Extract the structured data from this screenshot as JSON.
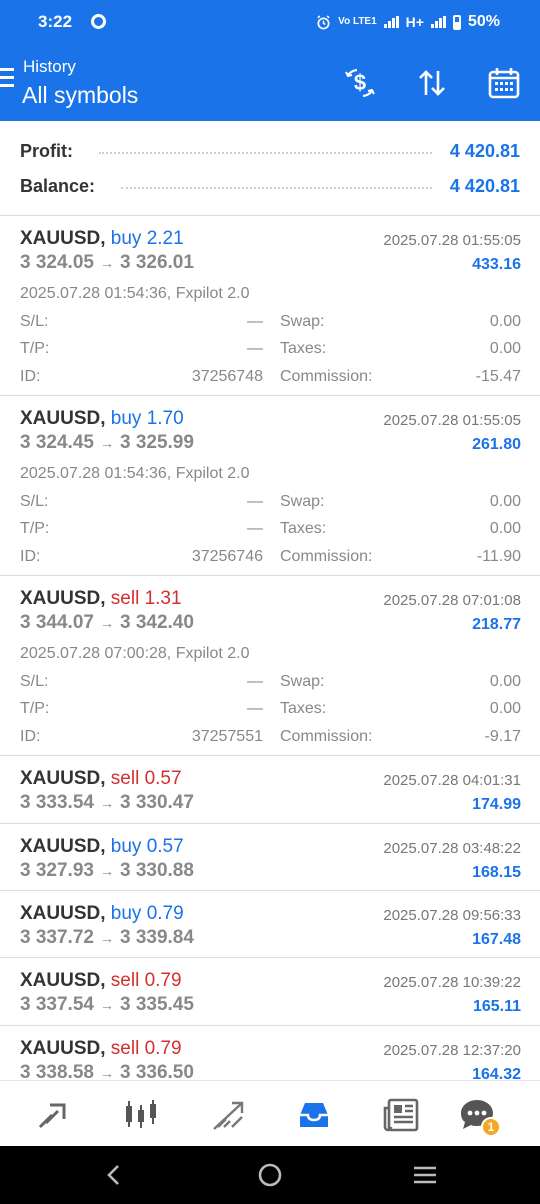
{
  "status_bar": {
    "time": "3:22",
    "network_small": "Vo LTE1",
    "network_type": "H+",
    "battery": "50%"
  },
  "app_bar": {
    "subtitle": "History",
    "title": "All symbols",
    "actions": [
      "dollar-sort-icon",
      "sort-arrows-icon",
      "calendar-icon"
    ]
  },
  "summary": {
    "profit_label": "Profit:",
    "profit_value": "4 420.81",
    "balance_label": "Balance:",
    "balance_value": "4 420.81"
  },
  "labels": {
    "sl": "S/L:",
    "tp": "T/P:",
    "id": "ID:",
    "swap": "Swap:",
    "taxes": "Taxes:",
    "commission": "Commission:",
    "arrow": "→"
  },
  "trades": [
    {
      "symbol": "XAUUSD,",
      "side": "buy 2.21",
      "type": "buy",
      "open_price": "3 324.05",
      "close_price": "3 326.01",
      "close_time": "2025.07.28 01:55:05",
      "profit": "433.16",
      "open_info": "2025.07.28 01:54:36, Fxpilot 2.0",
      "sl": "—",
      "tp": "—",
      "id": "37256748",
      "swap": "0.00",
      "taxes": "0.00",
      "commission": "-15.47"
    },
    {
      "symbol": "XAUUSD,",
      "side": "buy 1.70",
      "type": "buy",
      "open_price": "3 324.45",
      "close_price": "3 325.99",
      "close_time": "2025.07.28 01:55:05",
      "profit": "261.80",
      "open_info": "2025.07.28 01:54:36, Fxpilot 2.0",
      "sl": "—",
      "tp": "—",
      "id": "37256746",
      "swap": "0.00",
      "taxes": "0.00",
      "commission": "-11.90"
    },
    {
      "symbol": "XAUUSD,",
      "side": "sell 1.31",
      "type": "sell",
      "open_price": "3 344.07",
      "close_price": "3 342.40",
      "close_time": "2025.07.28 07:01:08",
      "profit": "218.77",
      "open_info": "2025.07.28 07:00:28, Fxpilot 2.0",
      "sl": "—",
      "tp": "—",
      "id": "37257551",
      "swap": "0.00",
      "taxes": "0.00",
      "commission": "-9.17"
    },
    {
      "symbol": "XAUUSD,",
      "side": "sell 0.57",
      "type": "sell",
      "open_price": "3 333.54",
      "close_price": "3 330.47",
      "close_time": "2025.07.28 04:01:31",
      "profit": "174.99"
    },
    {
      "symbol": "XAUUSD,",
      "side": "buy 0.57",
      "type": "buy",
      "open_price": "3 327.93",
      "close_price": "3 330.88",
      "close_time": "2025.07.28 03:48:22",
      "profit": "168.15"
    },
    {
      "symbol": "XAUUSD,",
      "side": "buy 0.79",
      "type": "buy",
      "open_price": "3 337.72",
      "close_price": "3 339.84",
      "close_time": "2025.07.28 09:56:33",
      "profit": "167.48"
    },
    {
      "symbol": "XAUUSD,",
      "side": "sell 0.79",
      "type": "sell",
      "open_price": "3 337.54",
      "close_price": "3 335.45",
      "close_time": "2025.07.28 10:39:22",
      "profit": "165.11"
    },
    {
      "symbol": "XAUUSD,",
      "side": "sell 0.79",
      "type": "sell",
      "open_price": "3 338.58",
      "close_price": "3 336.50",
      "close_time": "2025.07.28 12:37:20",
      "profit": "164.32"
    }
  ],
  "bottom_nav": {
    "items": [
      "quotes-icon",
      "chart-icon",
      "trade-icon",
      "history-icon",
      "news-icon",
      "chat-icon"
    ],
    "active": "history-icon",
    "chat_badge": "1"
  },
  "colors": {
    "accent": "#1a73e8",
    "sell": "#d32f2f",
    "badge": "#f5a623"
  }
}
